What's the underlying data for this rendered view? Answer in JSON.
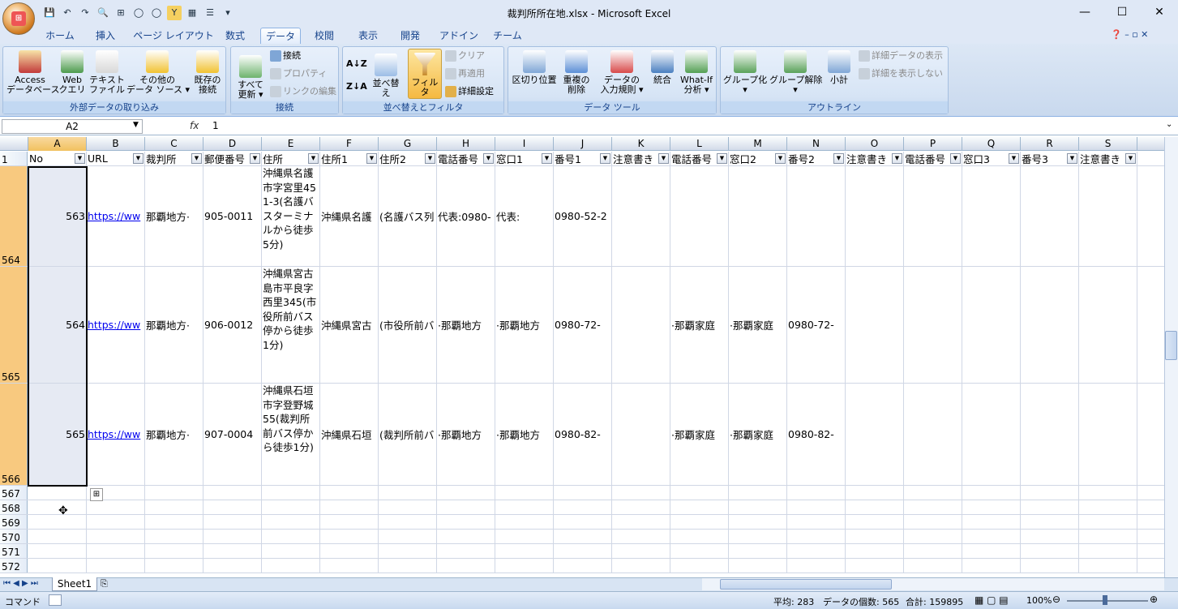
{
  "app": {
    "title": "裁判所所在地.xlsx - Microsoft Excel"
  },
  "window_controls": {
    "minimize": "—",
    "maximize": "☐",
    "close": "✕"
  },
  "tabs": [
    {
      "label": "ホーム"
    },
    {
      "label": "挿入"
    },
    {
      "label": "ページ レイアウト"
    },
    {
      "label": "数式"
    },
    {
      "label": "データ"
    },
    {
      "label": "校閲"
    },
    {
      "label": "表示"
    },
    {
      "label": "開発"
    },
    {
      "label": "アドイン"
    },
    {
      "label": "チーム"
    }
  ],
  "active_tab": "データ",
  "ribbon": {
    "groups": [
      {
        "label": "外部データの取り込み"
      },
      {
        "label": "接続"
      },
      {
        "label": "並べ替えとフィルタ"
      },
      {
        "label": "データ ツール"
      },
      {
        "label": "アウトライン"
      }
    ],
    "ext": {
      "access": "Access\nデータベース",
      "web": "Web\nクエリ",
      "text": "テキスト\nファイル",
      "other": "その他の\nデータ ソース ▾",
      "existing": "既存の\n接続"
    },
    "conn": {
      "refresh": "すべて\n更新 ▾",
      "connections": "接続",
      "properties": "プロパティ",
      "edit_links": "リンクの編集"
    },
    "sort": {
      "sort_btn": "並べ替え",
      "filter": "フィルタ",
      "clear": "クリア",
      "reapply": "再適用",
      "advanced": "詳細設定"
    },
    "tools": {
      "text_to_cols": "区切り位置",
      "remove_dup": "重複の\n削除",
      "validation": "データの\n入力規則 ▾",
      "consolidate": "統合",
      "whatif": "What-If\n分析 ▾"
    },
    "outline": {
      "group": "グループ化\n▾",
      "ungroup": "グループ解除\n▾",
      "subtotal": "小計",
      "show_detail": "詳細データの表示",
      "hide_detail": "詳細を表示しない"
    }
  },
  "formula_bar": {
    "name_box": "A2",
    "fx": "fx",
    "value": "1"
  },
  "columns": [
    "A",
    "B",
    "C",
    "D",
    "E",
    "F",
    "G",
    "H",
    "I",
    "J",
    "K",
    "L",
    "M",
    "N",
    "O",
    "P",
    "Q",
    "R",
    "S"
  ],
  "header_row": {
    "row_num": "1",
    "cells": [
      "No",
      "URL",
      "裁判所",
      "郵便番号",
      "住所",
      "住所1",
      "住所2",
      "電話番号",
      "窓口1",
      "番号1",
      "注意書き",
      "電話番号",
      "窓口2",
      "番号2",
      "注意書き",
      "電話番号",
      "窓口3",
      "番号3",
      "注意書き"
    ]
  },
  "rows": [
    {
      "row_num": "564",
      "cells": [
        "563",
        "https://ww",
        "那覇地方·",
        "905-0011",
        "沖縄県名護市字宮里451-3(名護バスターミナルから徒歩5分)",
        "沖縄県名護",
        "(名護バス列",
        "代表:0980-",
        "代表:",
        "0980-52-2",
        "",
        "",
        "",
        "",
        "",
        "",
        "",
        "",
        ""
      ]
    },
    {
      "row_num": "565",
      "cells": [
        "564",
        "https://ww",
        "那覇地方·",
        "906-0012",
        "沖縄県宮古島市平良字西里345(市役所前バス停から徒歩1分)",
        "沖縄県宮古",
        "(市役所前バ",
        "·那覇地方",
        "·那覇地方",
        "0980-72-",
        "",
        "·那覇家庭",
        "·那覇家庭",
        "0980-72-",
        "",
        "",
        "",
        "",
        ""
      ]
    },
    {
      "row_num": "566",
      "cells": [
        "565",
        "https://ww",
        "那覇地方·",
        "907-0004",
        "沖縄県石垣市字登野城55(裁判所前バス停から徒歩1分)",
        "沖縄県石垣",
        "(裁判所前バ",
        "·那覇地方",
        "·那覇地方",
        "0980-82-",
        "",
        "·那覇家庭",
        "·那覇家庭",
        "0980-82-",
        "",
        "",
        "",
        "",
        ""
      ]
    }
  ],
  "empty_rows": [
    "567",
    "568",
    "569",
    "570",
    "571",
    "572"
  ],
  "sheet_tabs": [
    {
      "label": "Sheet1"
    }
  ],
  "status": {
    "mode": "コマンド",
    "average": "平均: 283",
    "count": "データの個数: 565",
    "sum": "合計: 159895",
    "zoom": "100%"
  }
}
